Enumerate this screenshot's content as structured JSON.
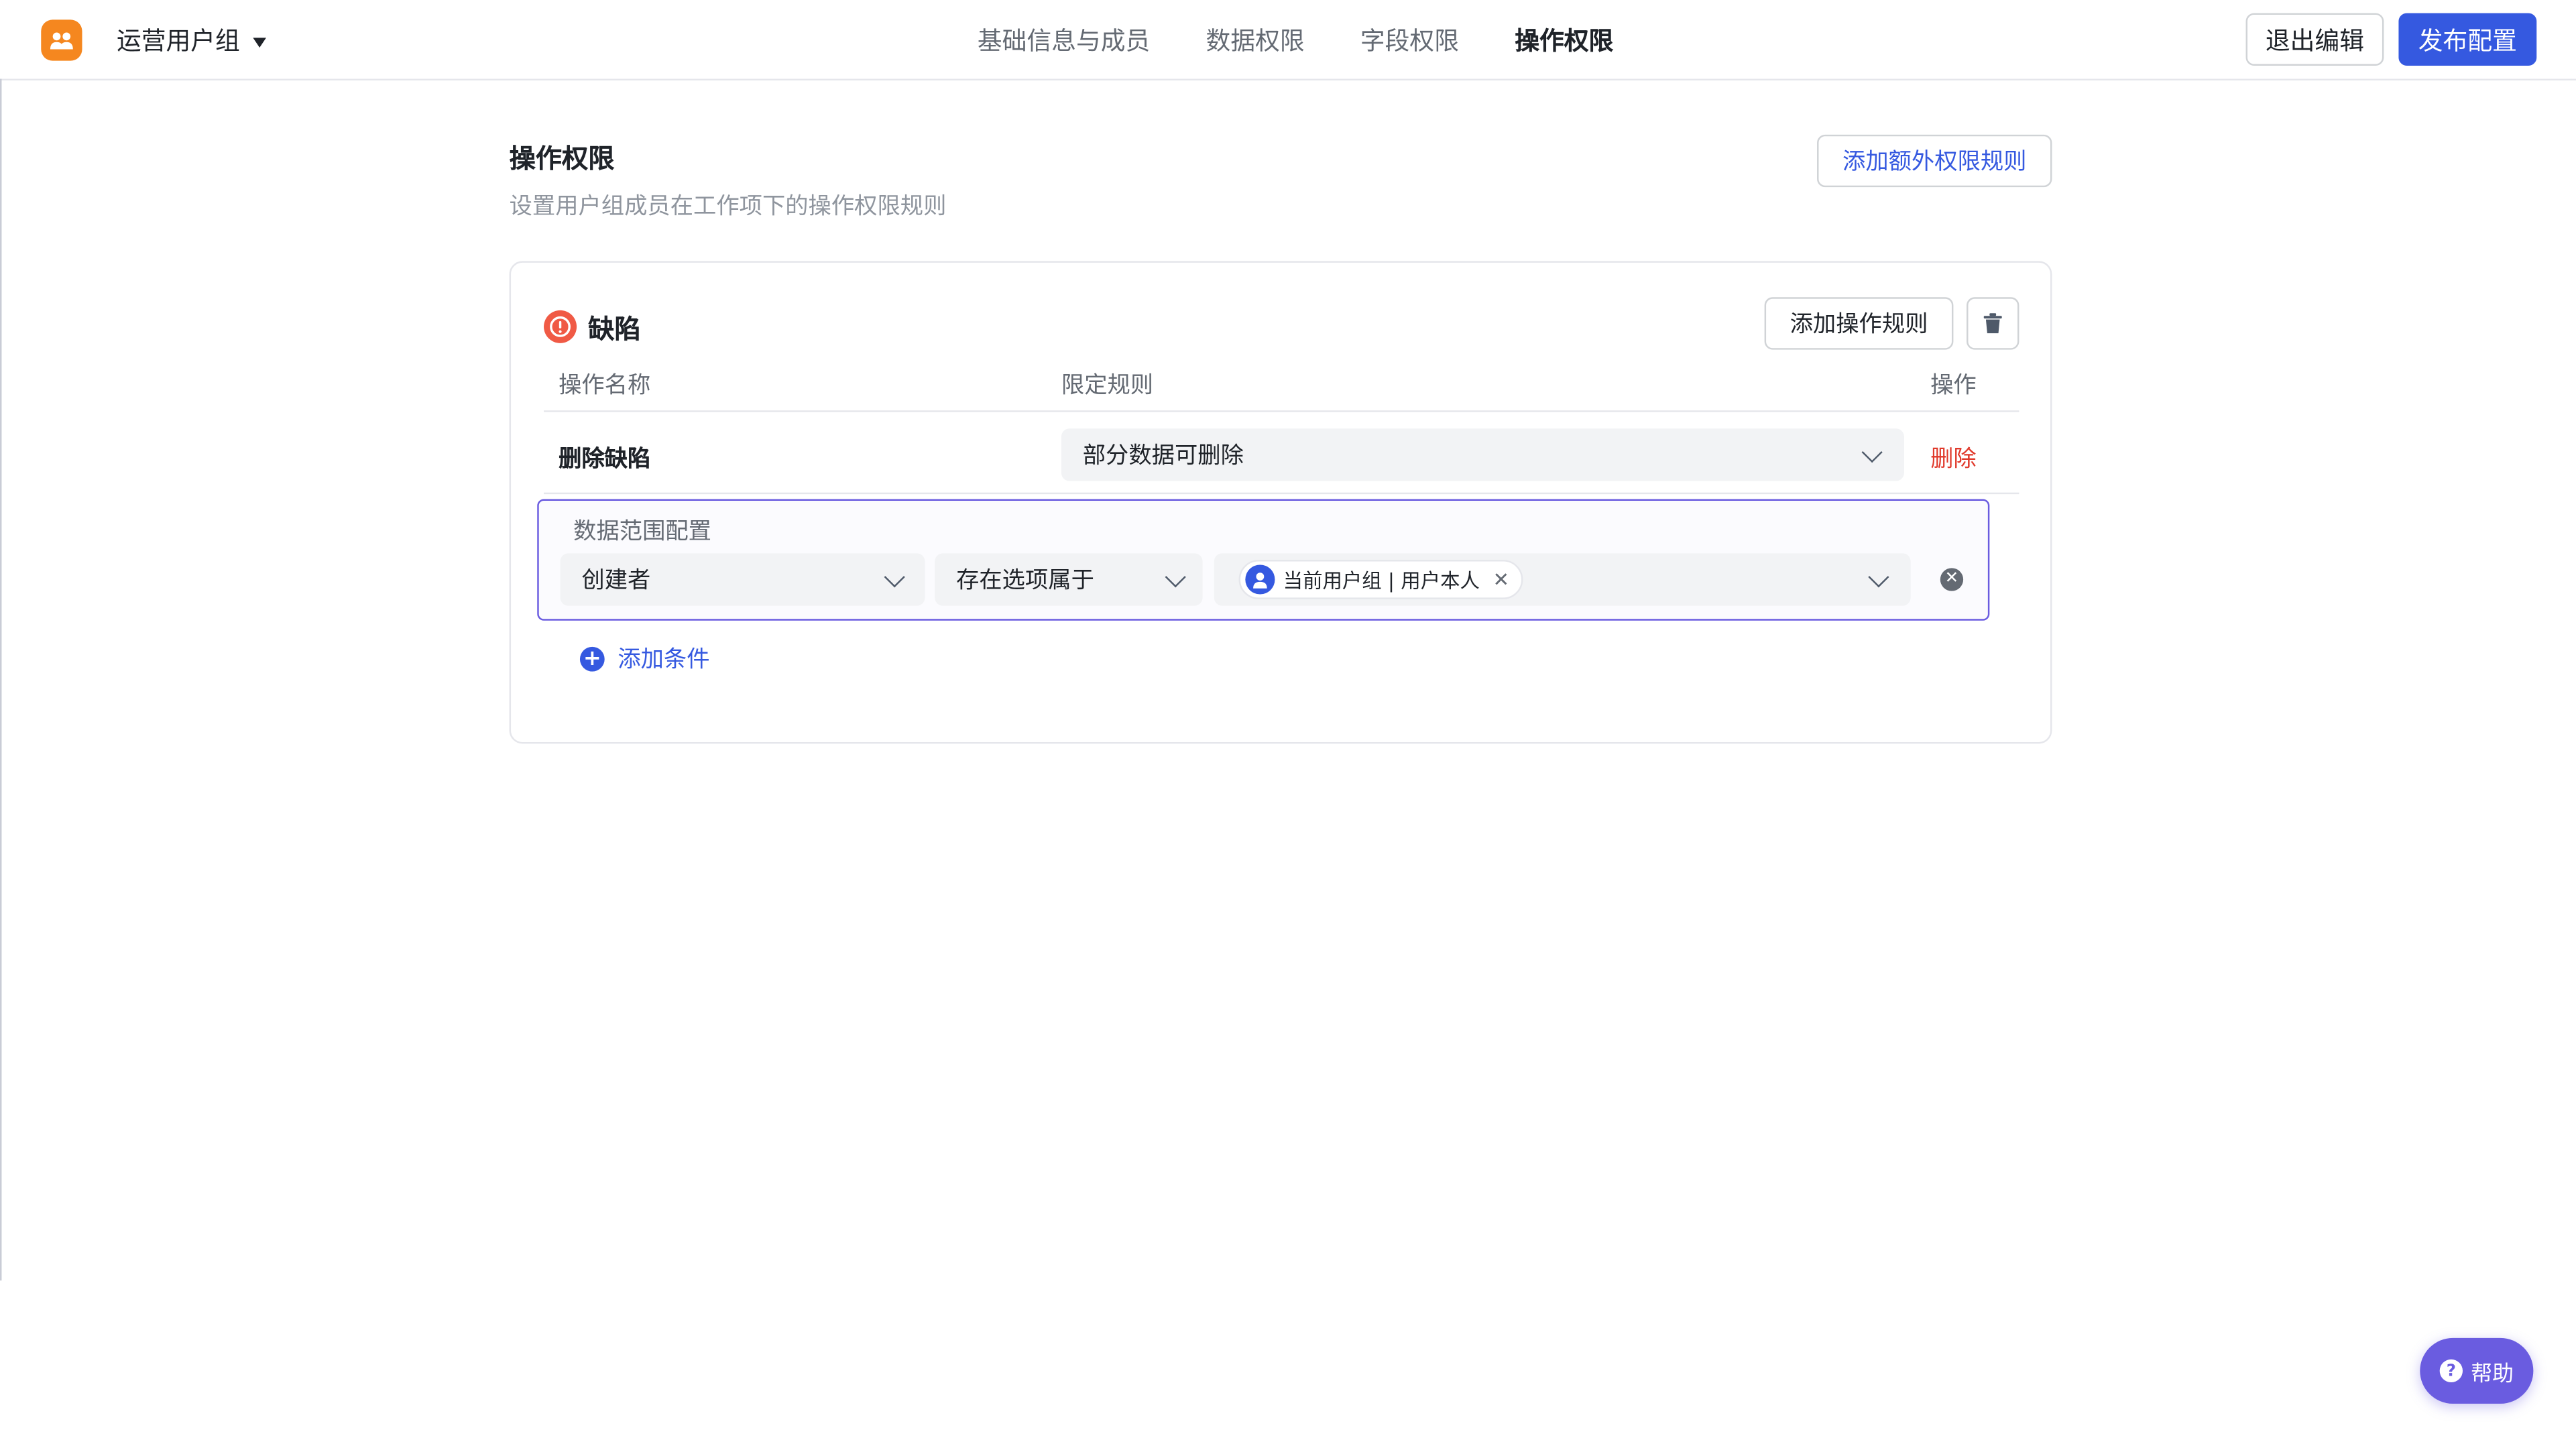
{
  "header": {
    "group_name": "运营用户组",
    "tabs": [
      {
        "label": "基础信息与成员",
        "active": false
      },
      {
        "label": "数据权限",
        "active": false
      },
      {
        "label": "字段权限",
        "active": false
      },
      {
        "label": "操作权限",
        "active": true
      }
    ],
    "exit_label": "退出编辑",
    "publish_label": "发布配置"
  },
  "section": {
    "title": "操作权限",
    "description": "设置用户组成员在工作项下的操作权限规则",
    "add_extra_label": "添加额外权限规则"
  },
  "card": {
    "title": "缺陷",
    "add_op_label": "添加操作规则",
    "columns": {
      "name": "操作名称",
      "rule": "限定规则",
      "action": "操作"
    },
    "row": {
      "name": "删除缺陷",
      "rule_value": "部分数据可删除",
      "delete_label": "删除"
    },
    "range": {
      "title": "数据范围配置",
      "field_value": "创建者",
      "operator_value": "存在选项属于",
      "chip_label": "当前用户组 | 用户本人"
    },
    "add_condition_label": "添加条件"
  },
  "help_label": "帮助",
  "colors": {
    "primary": "#3559e0",
    "accent": "#6a5ce0",
    "danger": "#e0392b",
    "logo": "#f5871f"
  }
}
